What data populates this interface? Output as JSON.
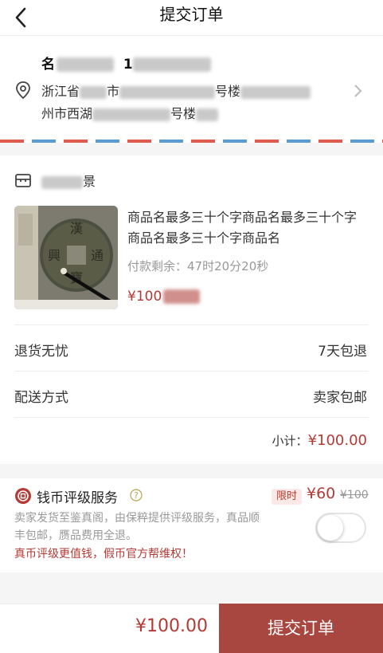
{
  "header": {
    "title": "提交订单"
  },
  "address": {
    "recipient_visible": "名",
    "phone_visible": "1",
    "line1_visible": "浙江省",
    "line1_fragment": "市",
    "line1_tail": "号楼",
    "line2_visible": "州市西湖",
    "line2_tail": "号楼"
  },
  "shop": {
    "name_tail": "景"
  },
  "product": {
    "name_line1": "商品名最多三十个字商品名最多三十个字",
    "name_line2": "商品名最多三十个字商品名",
    "countdown": "付款剩余：47时20分20秒",
    "price_visible": "¥100"
  },
  "rows": {
    "return_label": "退货无忧",
    "return_value": "7天包退",
    "delivery_label": "配送方式",
    "delivery_value": "卖家包邮",
    "subtotal_label": "小计：",
    "subtotal_amount": "¥100.00"
  },
  "service": {
    "title": "钱币评级服务",
    "badge": "限时",
    "price": "¥60",
    "original_price": "¥100",
    "desc": "卖家发货至鉴真阁，由保粹提供评级服务，真品顺丰包邮，赝品费用全退。",
    "note": "真币评级更值钱，假币官方帮维权！",
    "toggle_on": false
  },
  "footer": {
    "total": "¥100.00",
    "submit_label": "提交订单"
  },
  "colors": {
    "accent": "#a84640",
    "price": "#b33a35"
  }
}
